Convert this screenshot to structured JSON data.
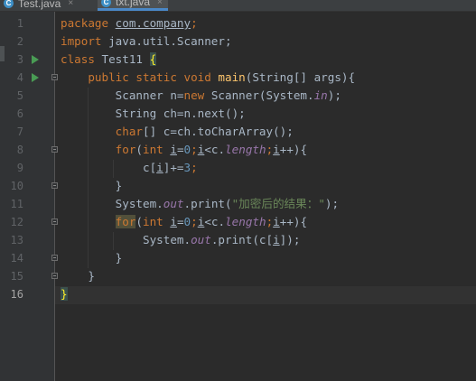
{
  "tabs": [
    {
      "icon": "C",
      "label": "Test.java",
      "close": "×"
    },
    {
      "icon": "C",
      "label": "txt.java",
      "close": "×"
    }
  ],
  "line_numbers": [
    "1",
    "2",
    "3",
    "4",
    "5",
    "6",
    "7",
    "8",
    "9",
    "10",
    "11",
    "12",
    "13",
    "14",
    "15",
    "16"
  ],
  "code": {
    "l1": {
      "kw": "package ",
      "pkg": "com.company",
      "end": ";"
    },
    "l2": {
      "kw": "import ",
      "rest": "java.util.Scanner;"
    },
    "l3": {
      "kw": "class ",
      "name": "Test11 ",
      "brace": "{"
    },
    "l4": {
      "kw": "public static void ",
      "method": "main",
      "rest": "(String[] args){"
    },
    "l5": {
      "a": "Scanner n=",
      "kw": "new ",
      "b": "Scanner(System.",
      "fld": "in",
      "c": ");"
    },
    "l6": {
      "text": "String ch=n.next();"
    },
    "l7": {
      "kw": "char",
      "rest": "[] c=ch.toCharArray();"
    },
    "l8": {
      "kw1": "for",
      "a": "(",
      "kw2": "int ",
      "v1": "i",
      "b": "=",
      "n0": "0",
      "c": ";",
      "v2": "i",
      "d": "<c.",
      "fld": "length",
      "e": ";",
      "v3": "i",
      "f": "++){"
    },
    "l9": {
      "a": "c[",
      "v": "i",
      "b": "]+=",
      "n": "3",
      "c": ";"
    },
    "l10": {
      "text": "}"
    },
    "l11": {
      "a": "System.",
      "fld": "out",
      "b": ".print(",
      "str": "\"加密后的结果：\"",
      "c": ");"
    },
    "l12": {
      "kw1": "for",
      "a": "(",
      "kw2": "int ",
      "v1": "i",
      "b": "=",
      "n0": "0",
      "c": ";",
      "v2": "i",
      "d": "<c.",
      "fld": "length",
      "e": ";",
      "v3": "i",
      "f": "++){"
    },
    "l13": {
      "a": "System.",
      "fld": "out",
      "b": ".print(c[",
      "v": "i",
      "c": "]);"
    },
    "l14": {
      "text": "}"
    },
    "l15": {
      "text": "}"
    },
    "l16": {
      "text": "}"
    }
  },
  "colors": {
    "background": "#2b2b2b",
    "keyword": "#cc7832",
    "method": "#ffc66d",
    "field": "#9876aa",
    "string": "#6a8759",
    "number": "#6897bb",
    "text": "#a9b7c6"
  }
}
